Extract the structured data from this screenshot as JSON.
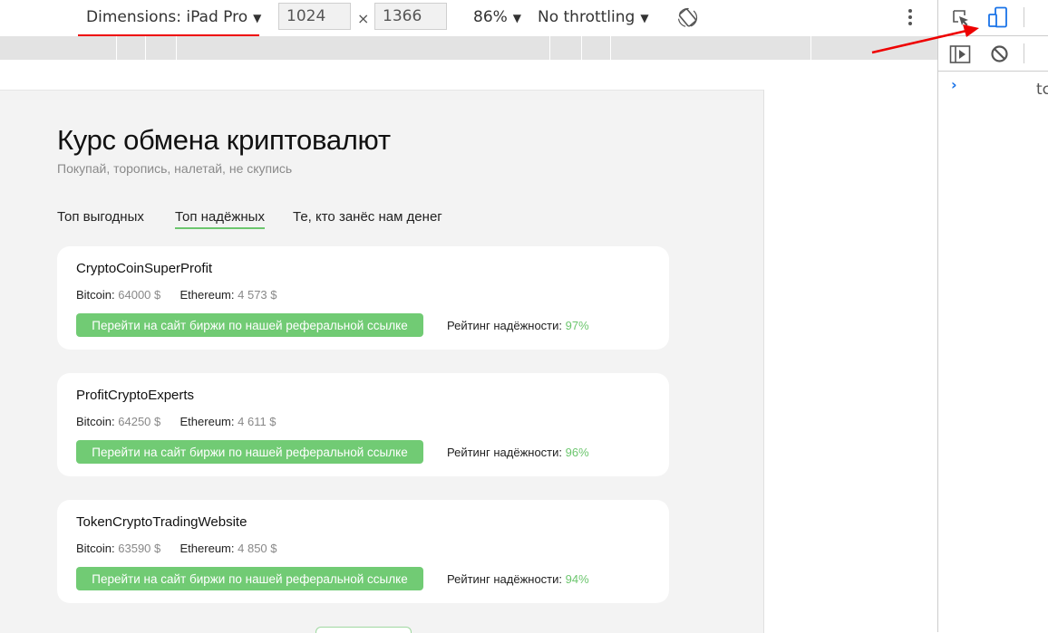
{
  "devtools": {
    "dimensions_label": "Dimensions: iPad Pro",
    "width_value": "1024",
    "height_value": "1366",
    "times_symbol": "×",
    "zoom_label": "86%",
    "throttle_label": "No throttling",
    "dropdown_arrow": "▼",
    "console_tab_partial": "tc",
    "console_prompt": "›",
    "annotation_color": "#e00000"
  },
  "page": {
    "title": "Курс обмена криптовалют",
    "subtitle": "Покупай, торопись, налетай, не скупись",
    "tabs": [
      {
        "label": "Топ выгодных",
        "active": false
      },
      {
        "label": "Топ надёжных",
        "active": true
      },
      {
        "label": "Те, кто занёс нам денег",
        "active": false
      }
    ],
    "accent_color": "#71cb74",
    "cards": [
      {
        "name": "CryptoCoinSuperProfit",
        "bitcoin_label": "Bitcoin:",
        "bitcoin_value": "64000 $",
        "ethereum_label": "Ethereum:",
        "ethereum_value": "4 573 $",
        "cta_label": "Перейти на сайт биржи по нашей реферальной ссылке",
        "rating_label": "Рейтинг надёжности:",
        "rating_value": "97%"
      },
      {
        "name": "ProfitCryptoExperts",
        "bitcoin_label": "Bitcoin:",
        "bitcoin_value": "64250 $",
        "ethereum_label": "Ethereum:",
        "ethereum_value": "4 611 $",
        "cta_label": "Перейти на сайт биржи по нашей реферальной ссылке",
        "rating_label": "Рейтинг надёжности:",
        "rating_value": "96%"
      },
      {
        "name": "TokenCryptoTradingWebsite",
        "bitcoin_label": "Bitcoin:",
        "bitcoin_value": "63590 $",
        "ethereum_label": "Ethereum:",
        "ethereum_value": "4 850 $",
        "cta_label": "Перейти на сайт биржи по нашей реферальной ссылке",
        "rating_label": "Рейтинг надёжности:",
        "rating_value": "94%"
      }
    ]
  }
}
